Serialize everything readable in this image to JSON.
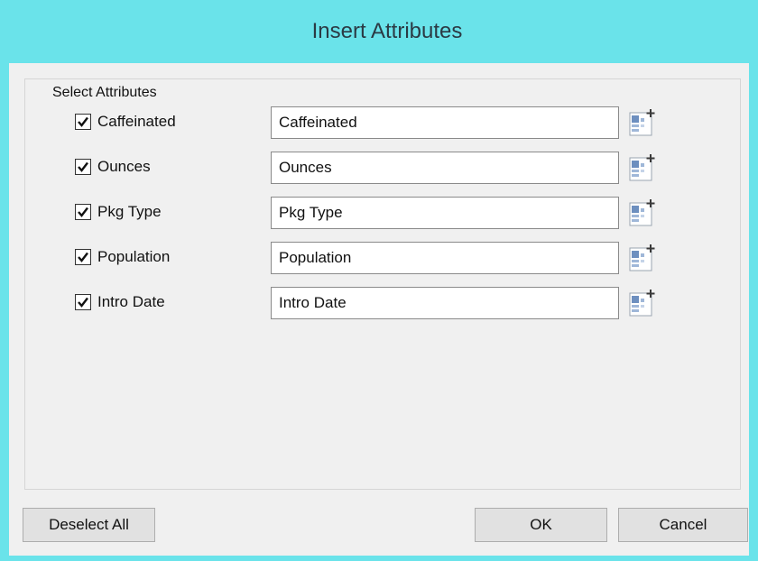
{
  "window": {
    "title": "Insert Attributes"
  },
  "group": {
    "legend": "Select Attributes"
  },
  "attributes": [
    {
      "label": "Caffeinated",
      "checked": true,
      "value": "Caffeinated",
      "picker_icon": "attribute-picker-icon"
    },
    {
      "label": "Ounces",
      "checked": true,
      "value": "Ounces",
      "picker_icon": "attribute-picker-icon"
    },
    {
      "label": "Pkg Type",
      "checked": true,
      "value": "Pkg Type",
      "picker_icon": "attribute-picker-icon"
    },
    {
      "label": "Population",
      "checked": true,
      "value": "Population",
      "picker_icon": "attribute-picker-icon"
    },
    {
      "label": "Intro Date",
      "checked": true,
      "value": "Intro Date",
      "picker_icon": "attribute-picker-icon"
    }
  ],
  "buttons": {
    "deselect_all": "Deselect All",
    "ok": "OK",
    "cancel": "Cancel"
  },
  "colors": {
    "title_bar": "#6ae3ea",
    "client_bg": "#f0f0f0",
    "button_bg": "#e1e1e1"
  }
}
